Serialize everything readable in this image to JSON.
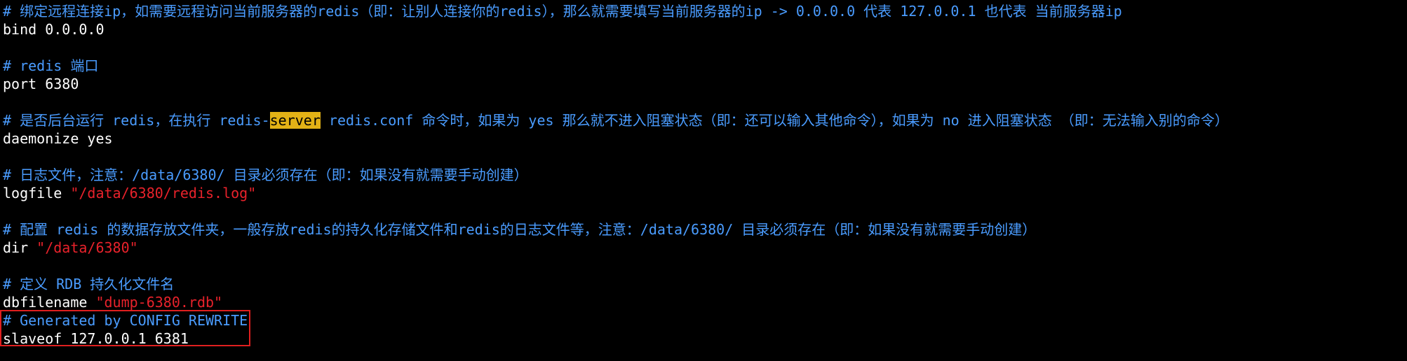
{
  "colors": {
    "background": "#000000",
    "comment": "#4a9cff",
    "text": "#ffffff",
    "string": "#e8222b",
    "highlight_bg": "#e3b216",
    "annotation_box": "#e01f1f"
  },
  "config": {
    "c1": "# 绑定远程连接ip，如需要远程访问当前服务器的redis（即：让别人连接你的redis），那么就需要填写当前服务器的ip -> 0.0.0.0 代表 127.0.0.1 也代表 当前服务器ip",
    "bind": "bind 0.0.0.0",
    "c2": "# redis 端口",
    "port": "port 6380",
    "c3_pre": "# 是否后台运行 redis，在执行 redis-",
    "c3_hl": "server",
    "c3_post": " redis.conf 命令时，如果为 yes 那么就不进入阻塞状态（即：还可以输入其他命令），如果为 no 进入阻塞状态 （即：无法输入别的命令）",
    "daemonize": "daemonize yes",
    "c4": "# 日志文件，注意：/data/6380/ 目录必须存在（即：如果没有就需要手动创建）",
    "logfile_key": "logfile ",
    "logfile_val": "\"/data/6380/redis.log\"",
    "c5": "# 配置 redis 的数据存放文件夹，一般存放redis的持久化存储文件和redis的日志文件等，注意：/data/6380/ 目录必须存在（即：如果没有就需要手动创建）",
    "dir_key": "dir ",
    "dir_val": "\"/data/6380\"",
    "c6": "# 定义 RDB 持久化文件名",
    "dbfilename_key": "dbfilename ",
    "dbfilename_val": "\"dump-6380.rdb\"",
    "c7": "# Generated by CONFIG REWRITE",
    "slaveof": "slaveof 127.0.0.1 6381"
  }
}
